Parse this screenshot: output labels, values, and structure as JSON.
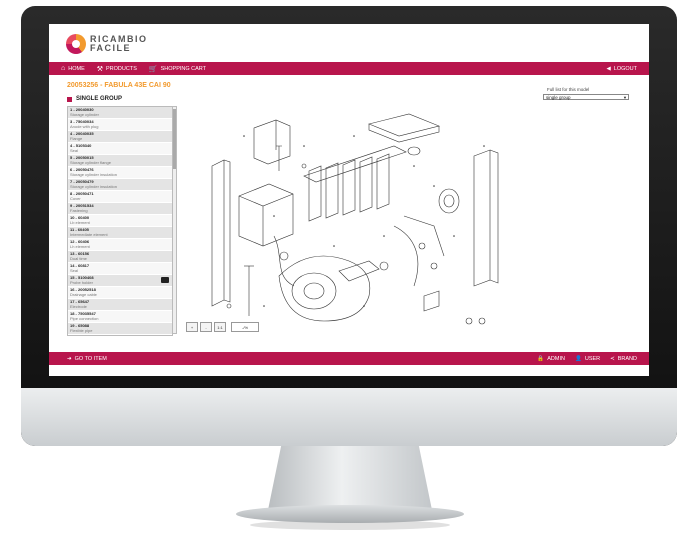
{
  "brand": {
    "line1": "RICAMBIO",
    "line2": "FACILE"
  },
  "nav": {
    "home": "HOME",
    "products": "PRODUCTS",
    "cart": "SHOPPING CART",
    "logout": "LOGOUT"
  },
  "model": {
    "title": "20053256 - FABULA 43E CAI 90",
    "full_list": "Full list for this model",
    "selected_group": "single group"
  },
  "group": {
    "title": "SINGLE GROUP"
  },
  "parts": [
    {
      "code": "1 - 20040030",
      "desc": "Storage cylinder"
    },
    {
      "code": "3 - 75040034",
      "desc": "Anode with plug"
    },
    {
      "code": "4 - 20040035",
      "desc": "Flange"
    },
    {
      "code": "4 - 5105340",
      "desc": "Seal"
    },
    {
      "code": "5 - 20050015",
      "desc": "Storage cylinder flange"
    },
    {
      "code": "6 - 20050476",
      "desc": "Storage cylinder insulation"
    },
    {
      "code": "7 - 20050479",
      "desc": "Storage cylinder insulation"
    },
    {
      "code": "8 - 20050471",
      "desc": "Cover"
    },
    {
      "code": "9 - 20051534",
      "desc": "Fastening"
    },
    {
      "code": "10 - 60400",
      "desc": "Lb element"
    },
    {
      "code": "11 - 60405",
      "desc": "Intermediate element"
    },
    {
      "code": "12 - 60406",
      "desc": "Lh element"
    },
    {
      "code": "13 - 60156",
      "desc": "Dual time"
    },
    {
      "code": "14 - 60817",
      "desc": "Seal"
    },
    {
      "code": "15 - 5100408",
      "desc": "Probe holder"
    },
    {
      "code": "16 - 20052518",
      "desc": "Drainage cable"
    },
    {
      "code": "17 - 65647",
      "desc": "Electrode"
    },
    {
      "code": "18 - 75035547",
      "desc": "Pipe connection"
    },
    {
      "code": "19 - 65088",
      "desc": "Flexible pipe"
    },
    {
      "code": "20 - 75006476",
      "desc": "Seal"
    },
    {
      "code": "21 - 60096",
      "desc": "Gas nozzle final regulation"
    }
  ],
  "toolbar": {
    "b1": "+",
    "b2": "-",
    "b3": "1:1",
    "zoom": "-/%"
  },
  "footer": {
    "go_to_item": "GO TO ITEM",
    "admin": "ADMIN",
    "user": "USER",
    "brand": "BRAND"
  },
  "colors": {
    "accent": "#b8154c",
    "title_orange": "#f29a2e"
  }
}
